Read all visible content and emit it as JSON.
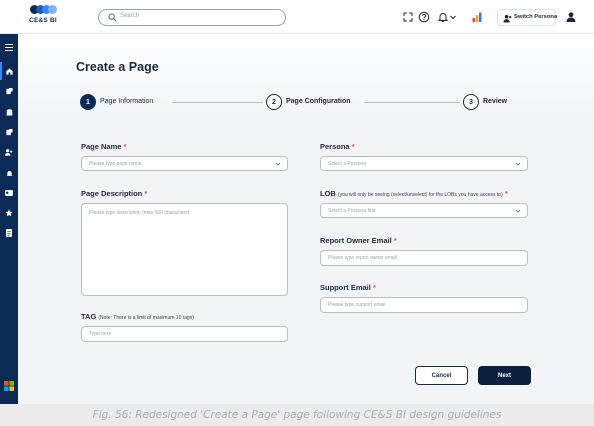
{
  "app": {
    "logo_text": "CE&S BI"
  },
  "topbar": {
    "search_placeholder": "Search",
    "switch_persona_label": "Switch Persona"
  },
  "page": {
    "title": "Create a Page",
    "steps": [
      {
        "number": "1",
        "label": "Page Information"
      },
      {
        "number": "2",
        "label": "Page Configuration"
      },
      {
        "number": "3",
        "label": "Review"
      }
    ]
  },
  "form": {
    "page_name": {
      "label": "Page Name",
      "required_mark": "*",
      "placeholder": "Please type page name"
    },
    "page_description": {
      "label": "Page Description",
      "required_mark": "*",
      "placeholder": "Please type description (max 500 characters)"
    },
    "tag": {
      "label": "TAG",
      "note": "(Note: There is a limit of maximum 10 tags)",
      "placeholder": "Type here"
    },
    "persona": {
      "label": "Persona",
      "required_mark": "*",
      "placeholder": "Select a Persona"
    },
    "lob": {
      "label": "LOB",
      "note": "(you will only be seeing (select/unselect) for the LOBs you have access to)",
      "required_mark": "*",
      "placeholder": "Select a Persona first"
    },
    "report_owner_email": {
      "label": "Report Owner Email",
      "required_mark": "*",
      "placeholder": "Please type report owner email"
    },
    "support_email": {
      "label": "Support Email",
      "required_mark": "*",
      "placeholder": "Please type support email"
    }
  },
  "actions": {
    "cancel": "Cancel",
    "next": "Next"
  },
  "caption": "Fig. 56: Redesigned 'Create a Page' page following CE&S BI design guidelines",
  "colors": {
    "navy": "#0b2a55",
    "accent_blue": "#3a86ff",
    "required_red": "#e5484d"
  },
  "icons": [
    "search-icon",
    "expand-icon",
    "help-icon",
    "bell-icon",
    "chart-icon",
    "user-icon",
    "avatar-icon",
    "menu-icon",
    "home-icon"
  ]
}
